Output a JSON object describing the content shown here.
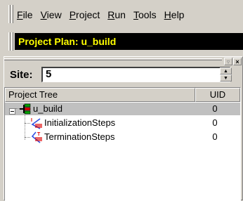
{
  "menu": {
    "items": [
      {
        "label": "File",
        "accel": "F",
        "rest": "ile"
      },
      {
        "label": "View",
        "accel": "V",
        "rest": "iew"
      },
      {
        "label": "Project",
        "accel": "P",
        "rest": "roject"
      },
      {
        "label": "Run",
        "accel": "R",
        "rest": "un"
      },
      {
        "label": "Tools",
        "accel": "T",
        "rest": "ools"
      },
      {
        "label": "Help",
        "accel": "H",
        "rest": "elp"
      }
    ]
  },
  "title": "Project Plan: u_build",
  "site": {
    "label": "Site:",
    "value": "5"
  },
  "tree": {
    "columns": {
      "name": "Project Tree",
      "uid": "UID"
    },
    "rows": [
      {
        "name": "u_build",
        "uid": "0"
      },
      {
        "name": "InitializationSteps",
        "uid": "0"
      },
      {
        "name": "TerminationSteps",
        "uid": "0"
      }
    ]
  },
  "icons": {
    "collapse": "minus-box-icon",
    "project": "project-tree-icon",
    "step": "step-branch-icon"
  },
  "colors": {
    "title_bg": "#000000",
    "title_fg": "#ffff00",
    "face": "#d4d0c8",
    "selection": "#c0c0c0"
  }
}
